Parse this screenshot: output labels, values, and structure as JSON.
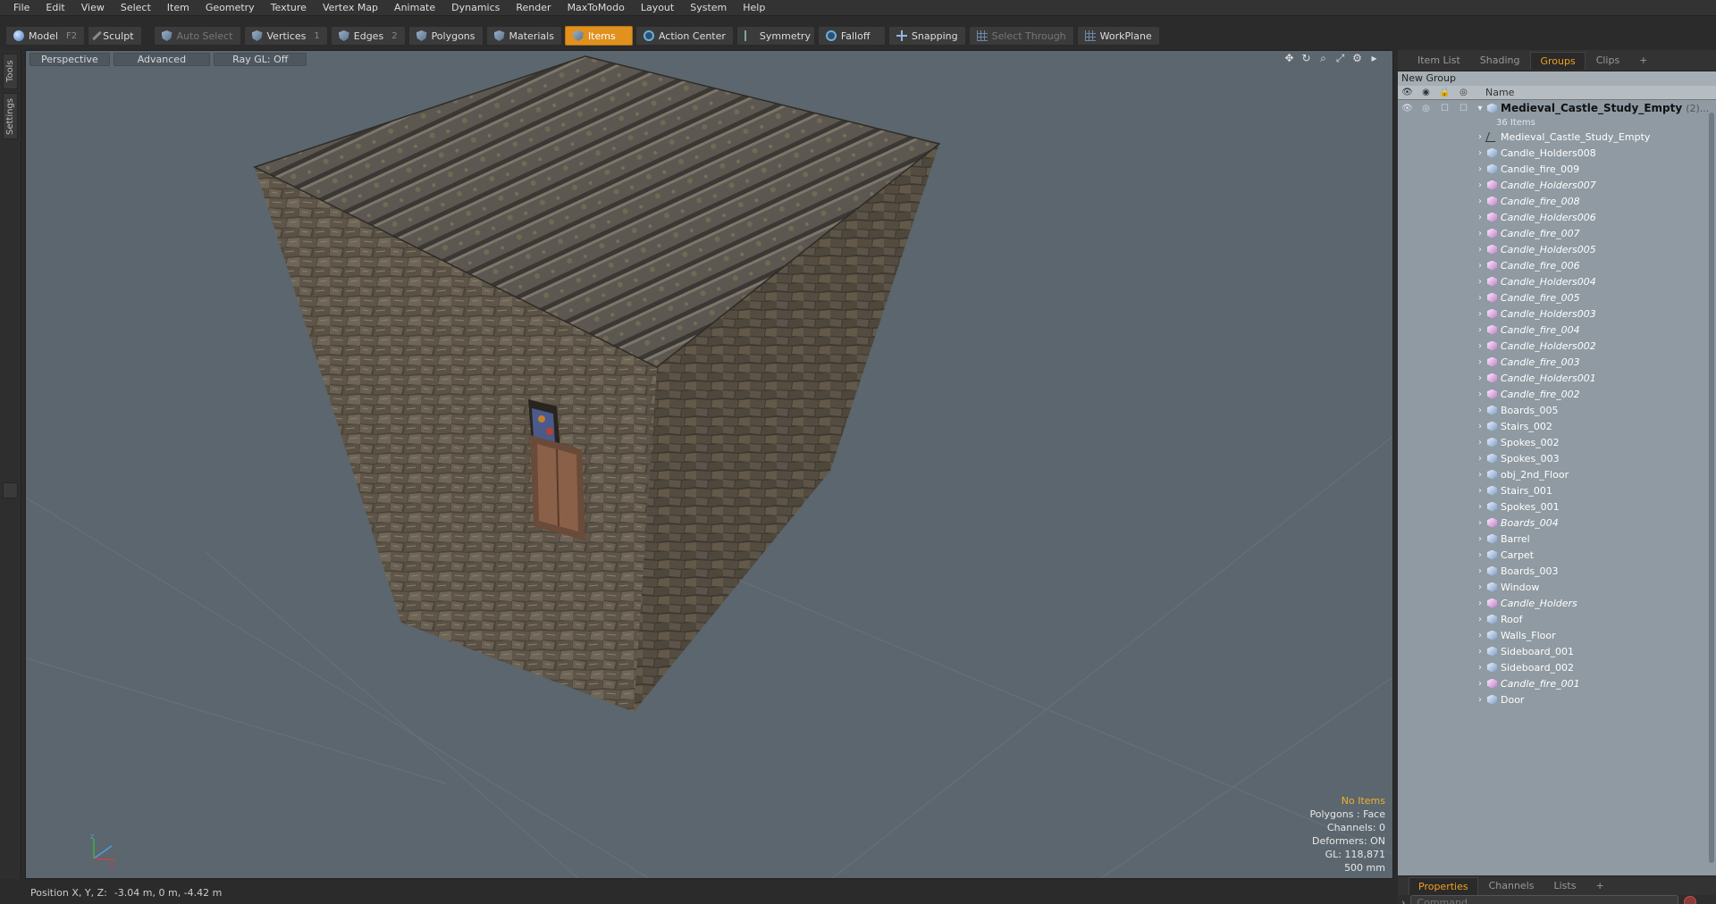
{
  "menu": [
    "File",
    "Edit",
    "View",
    "Select",
    "Item",
    "Geometry",
    "Texture",
    "Vertex Map",
    "Animate",
    "Dynamics",
    "Render",
    "MaxToModo",
    "Layout",
    "System",
    "Help"
  ],
  "toolbar": {
    "model": "Model",
    "model_key": "F2",
    "sculpt": "Sculpt",
    "auto_select": "Auto Select",
    "vertices": "Vertices",
    "vertices_key": "1",
    "edges": "Edges",
    "edges_key": "2",
    "polygons": "Polygons",
    "materials": "Materials",
    "items": "Items",
    "action_center": "Action Center",
    "symmetry": "Symmetry",
    "falloff": "Falloff",
    "snapping": "Snapping",
    "select_through": "Select Through",
    "workplane": "WorkPlane",
    "accent": "#e0911e"
  },
  "side_tabs": {
    "tools": "Tools",
    "settings": "Settings"
  },
  "viewport": {
    "tabs": [
      "Perspective",
      "Advanced",
      "Ray GL: Off"
    ],
    "info": [
      "No Items",
      "Polygons : Face",
      "Channels: 0",
      "Deformers: ON",
      "GL: 118,871",
      "500 mm"
    ],
    "bg_color": "#5b666e"
  },
  "status": {
    "label": "Position X, Y, Z:",
    "value": "-3.04 m, 0 m, -4.42 m"
  },
  "right_panel": {
    "tabs": [
      "Item List",
      "Shading",
      "Groups",
      "Clips",
      "+"
    ],
    "active_tab": "Groups",
    "new_group": "New Group",
    "name_header": "Name",
    "group_name": "Medieval_Castle_Study_Empty",
    "group_count": "(2)...",
    "items_count": "36 Items",
    "items": [
      {
        "name": "Medieval_Castle_Study_Empty",
        "type": "locator",
        "italic": false
      },
      {
        "name": "Candle_Holders008",
        "type": "mesh",
        "italic": false
      },
      {
        "name": "Candle_fire_009",
        "type": "mesh",
        "italic": false
      },
      {
        "name": "Candle_Holders007",
        "type": "mesh",
        "italic": true
      },
      {
        "name": "Candle_fire_008",
        "type": "mesh",
        "italic": true
      },
      {
        "name": "Candle_Holders006",
        "type": "mesh",
        "italic": true
      },
      {
        "name": "Candle_fire_007",
        "type": "mesh",
        "italic": true
      },
      {
        "name": "Candle_Holders005",
        "type": "mesh",
        "italic": true
      },
      {
        "name": "Candle_fire_006",
        "type": "mesh",
        "italic": true
      },
      {
        "name": "Candle_Holders004",
        "type": "mesh",
        "italic": true
      },
      {
        "name": "Candle_fire_005",
        "type": "mesh",
        "italic": true
      },
      {
        "name": "Candle_Holders003",
        "type": "mesh",
        "italic": true
      },
      {
        "name": "Candle_fire_004",
        "type": "mesh",
        "italic": true
      },
      {
        "name": "Candle_Holders002",
        "type": "mesh",
        "italic": true
      },
      {
        "name": "Candle_fire_003",
        "type": "mesh",
        "italic": true
      },
      {
        "name": "Candle_Holders001",
        "type": "mesh",
        "italic": true
      },
      {
        "name": "Candle_fire_002",
        "type": "mesh",
        "italic": true
      },
      {
        "name": "Boards_005",
        "type": "mesh",
        "italic": false
      },
      {
        "name": "Stairs_002",
        "type": "mesh",
        "italic": false
      },
      {
        "name": "Spokes_002",
        "type": "mesh",
        "italic": false
      },
      {
        "name": "Spokes_003",
        "type": "mesh",
        "italic": false
      },
      {
        "name": "obj_2nd_Floor",
        "type": "mesh",
        "italic": false
      },
      {
        "name": "Stairs_001",
        "type": "mesh",
        "italic": false
      },
      {
        "name": "Spokes_001",
        "type": "mesh",
        "italic": false
      },
      {
        "name": "Boards_004",
        "type": "mesh",
        "italic": true
      },
      {
        "name": "Barrel",
        "type": "mesh",
        "italic": false
      },
      {
        "name": "Carpet",
        "type": "mesh",
        "italic": false
      },
      {
        "name": "Boards_003",
        "type": "mesh",
        "italic": false
      },
      {
        "name": "Window",
        "type": "mesh",
        "italic": false
      },
      {
        "name": "Candle_Holders",
        "type": "mesh",
        "italic": true
      },
      {
        "name": "Roof",
        "type": "mesh",
        "italic": false
      },
      {
        "name": "Walls_Floor",
        "type": "mesh",
        "italic": false
      },
      {
        "name": "Sideboard_001",
        "type": "mesh",
        "italic": false
      },
      {
        "name": "Sideboard_002",
        "type": "mesh",
        "italic": false
      },
      {
        "name": "Candle_fire_001",
        "type": "mesh",
        "italic": true
      },
      {
        "name": "Door",
        "type": "mesh",
        "italic": false
      }
    ],
    "bottom_tabs": [
      "Properties",
      "Channels",
      "Lists",
      "+"
    ],
    "active_bottom_tab": "Properties",
    "command_placeholder": "Command"
  }
}
